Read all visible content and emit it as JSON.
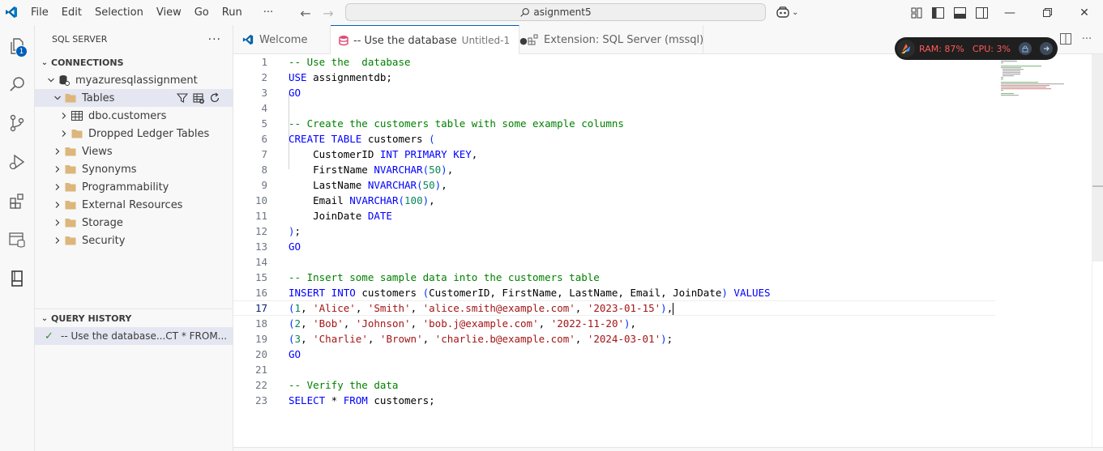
{
  "menu": [
    "File",
    "Edit",
    "Selection",
    "View",
    "Go",
    "Run",
    "···"
  ],
  "command_center": {
    "text": "asignment5"
  },
  "activity_badge": "1",
  "sidebar": {
    "title": "SQL SERVER",
    "more": "···",
    "connections_header": "CONNECTIONS",
    "server": "myazuresqlassignment",
    "tables_label": "Tables",
    "table_item": "dbo.customers",
    "dropped_ledger": "Dropped Ledger Tables",
    "folders": [
      "Views",
      "Synonyms",
      "Programmability",
      "External Resources",
      "Storage",
      "Security"
    ],
    "query_history_header": "QUERY HISTORY",
    "query_history_item": "-- Use the  database...CT * FROM..."
  },
  "tabs": [
    {
      "label": "Welcome",
      "desc": ""
    },
    {
      "label": "-- Use the database",
      "desc": "Untitled-1",
      "dirty": "●"
    },
    {
      "label": "Extension: SQL Server (mssql)",
      "desc": ""
    }
  ],
  "monitor": {
    "ram": "RAM: 87%",
    "cpu": "CPU: 3%"
  },
  "editor": {
    "current_line": 17,
    "lines": [
      {
        "n": "1",
        "tokens": [
          [
            "c",
            "-- Use the  database"
          ]
        ]
      },
      {
        "n": "2",
        "tokens": [
          [
            "k",
            "USE"
          ],
          [
            "p",
            " assignmentdb;"
          ]
        ]
      },
      {
        "n": "3",
        "tokens": [
          [
            "k",
            "GO"
          ]
        ]
      },
      {
        "n": "4",
        "tokens": []
      },
      {
        "n": "5",
        "tokens": [
          [
            "c",
            "-- Create the customers table with some example columns"
          ]
        ]
      },
      {
        "n": "6",
        "tokens": [
          [
            "k",
            "CREATE TABLE"
          ],
          [
            "p",
            " customers "
          ],
          [
            "u",
            "("
          ]
        ]
      },
      {
        "n": "7",
        "tokens": [
          [
            "p",
            "    CustomerID "
          ],
          [
            "k",
            "INT PRIMARY KEY"
          ],
          [
            "p",
            ","
          ]
        ]
      },
      {
        "n": "8",
        "tokens": [
          [
            "p",
            "    FirstName "
          ],
          [
            "k",
            "NVARCHAR"
          ],
          [
            "u",
            "("
          ],
          [
            "n",
            "50"
          ],
          [
            "u",
            ")"
          ],
          [
            "p",
            ","
          ]
        ]
      },
      {
        "n": "9",
        "tokens": [
          [
            "p",
            "    LastName "
          ],
          [
            "k",
            "NVARCHAR"
          ],
          [
            "u",
            "("
          ],
          [
            "n",
            "50"
          ],
          [
            "u",
            ")"
          ],
          [
            "p",
            ","
          ]
        ]
      },
      {
        "n": "10",
        "tokens": [
          [
            "p",
            "    Email "
          ],
          [
            "k",
            "NVARCHAR"
          ],
          [
            "u",
            "("
          ],
          [
            "n",
            "100"
          ],
          [
            "u",
            ")"
          ],
          [
            "p",
            ","
          ]
        ]
      },
      {
        "n": "11",
        "tokens": [
          [
            "p",
            "    JoinDate "
          ],
          [
            "k",
            "DATE"
          ]
        ]
      },
      {
        "n": "12",
        "tokens": [
          [
            "u",
            ")"
          ],
          [
            "p",
            ";"
          ]
        ]
      },
      {
        "n": "13",
        "tokens": [
          [
            "k",
            "GO"
          ]
        ]
      },
      {
        "n": "14",
        "tokens": []
      },
      {
        "n": "15",
        "tokens": [
          [
            "c",
            "-- Insert some sample data into the customers table"
          ]
        ]
      },
      {
        "n": "16",
        "tokens": [
          [
            "k",
            "INSERT INTO"
          ],
          [
            "p",
            " customers "
          ],
          [
            "u",
            "("
          ],
          [
            "p",
            "CustomerID, FirstName, LastName, Email, JoinDate"
          ],
          [
            "u",
            ")"
          ],
          [
            "k",
            " VALUES"
          ]
        ]
      },
      {
        "n": "17",
        "tokens": [
          [
            "u",
            "("
          ],
          [
            "n",
            "1"
          ],
          [
            "p",
            ", "
          ],
          [
            "s",
            "'Alice'"
          ],
          [
            "p",
            ", "
          ],
          [
            "s",
            "'Smith'"
          ],
          [
            "p",
            ", "
          ],
          [
            "s",
            "'alice.smith@example.com'"
          ],
          [
            "p",
            ", "
          ],
          [
            "s",
            "'2023-01-15'"
          ],
          [
            "u",
            ")"
          ],
          [
            "p",
            ","
          ]
        ]
      },
      {
        "n": "18",
        "tokens": [
          [
            "u",
            "("
          ],
          [
            "n",
            "2"
          ],
          [
            "p",
            ", "
          ],
          [
            "s",
            "'Bob'"
          ],
          [
            "p",
            ", "
          ],
          [
            "s",
            "'Johnson'"
          ],
          [
            "p",
            ", "
          ],
          [
            "s",
            "'bob.j@example.com'"
          ],
          [
            "p",
            ", "
          ],
          [
            "s",
            "'2022-11-20'"
          ],
          [
            "u",
            ")"
          ],
          [
            "p",
            ","
          ]
        ]
      },
      {
        "n": "19",
        "tokens": [
          [
            "u",
            "("
          ],
          [
            "n",
            "3"
          ],
          [
            "p",
            ", "
          ],
          [
            "s",
            "'Charlie'"
          ],
          [
            "p",
            ", "
          ],
          [
            "s",
            "'Brown'"
          ],
          [
            "p",
            ", "
          ],
          [
            "s",
            "'charlie.b@example.com'"
          ],
          [
            "p",
            ", "
          ],
          [
            "s",
            "'2024-03-01'"
          ],
          [
            "u",
            ")"
          ],
          [
            "p",
            ";"
          ]
        ]
      },
      {
        "n": "20",
        "tokens": [
          [
            "k",
            "GO"
          ]
        ]
      },
      {
        "n": "21",
        "tokens": []
      },
      {
        "n": "22",
        "tokens": [
          [
            "c",
            "-- Verify the data"
          ]
        ]
      },
      {
        "n": "23",
        "tokens": [
          [
            "k",
            "SELECT"
          ],
          [
            "p",
            " * "
          ],
          [
            "k",
            "FROM"
          ],
          [
            "p",
            " customers;"
          ]
        ]
      }
    ]
  },
  "colors": {
    "accent": "#005fb8",
    "comment": "#008000",
    "keyword": "#0000ff",
    "string": "#a31515",
    "number": "#098658",
    "monitor_text": "#ff5a5a"
  }
}
